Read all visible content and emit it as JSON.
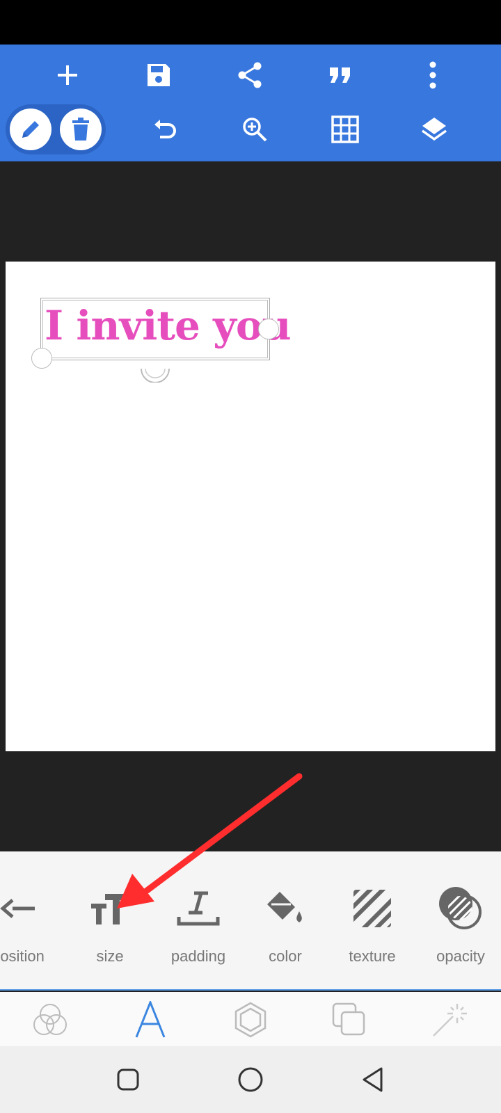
{
  "toolbar": {
    "row1": [
      "add-icon",
      "save-icon",
      "share-icon",
      "quote-icon",
      "more-vert-icon"
    ],
    "row2": [
      "pencil-icon",
      "trash-icon",
      "undo-icon",
      "zoom-in-icon",
      "grid-icon",
      "layers-icon"
    ],
    "accent": "#3877dd"
  },
  "canvas": {
    "text": "I invite you",
    "text_color": "#e64ebd"
  },
  "properties": {
    "items": [
      {
        "label": "position",
        "icon": "position-arrow-icon"
      },
      {
        "label": "size",
        "icon": "text-size-icon"
      },
      {
        "label": "padding",
        "icon": "padding-icon"
      },
      {
        "label": "color",
        "icon": "paint-bucket-icon"
      },
      {
        "label": "texture",
        "icon": "texture-stripes-icon"
      },
      {
        "label": "opacity",
        "icon": "opacity-icon"
      }
    ]
  },
  "tabs": [
    "blend-icon",
    "text-tab-icon",
    "shape-icon",
    "duplicate-icon",
    "magic-wand-icon"
  ],
  "annotation": {
    "arrow_color": "#ff2d2d"
  }
}
